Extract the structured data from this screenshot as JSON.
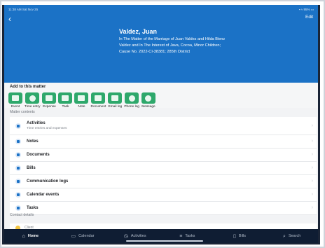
{
  "status_bar": {
    "time_date": "11:38 AM  Sat Nov 25",
    "battery": "▪︎ ≈ 95% ▭"
  },
  "header": {
    "back_glyph": "‹",
    "edit_label": "Edit",
    "client_name": "Valdez, Juan",
    "matter_description": "In The Matter of the Marriage of Juan Valdez and Hilda Bienz Valdez and In The Interest of Java, Cocoa, Minor Children; Cause No. 2022-CI-38381; 285th District"
  },
  "add_to_matter": {
    "title": "Add to this matter",
    "actions": [
      {
        "label": "Event",
        "icon": "calendar-icon"
      },
      {
        "label": "Time entry",
        "icon": "clock-icon"
      },
      {
        "label": "Expense",
        "icon": "receipt-icon"
      },
      {
        "label": "Task",
        "icon": "task-icon"
      },
      {
        "label": "Note",
        "icon": "note-icon"
      },
      {
        "label": "Document",
        "icon": "document-icon"
      },
      {
        "label": "Email log",
        "icon": "email-icon"
      },
      {
        "label": "Phone log",
        "icon": "phone-icon"
      },
      {
        "label": "Message",
        "icon": "message-icon"
      }
    ]
  },
  "matter_contents": {
    "heading": "Matter contents",
    "items": [
      {
        "label": "Activities",
        "sub": "Time entries and expenses",
        "icon": "activities-icon"
      },
      {
        "label": "Notes",
        "icon": "note-icon"
      },
      {
        "label": "Documents",
        "icon": "document-icon"
      },
      {
        "label": "Bills",
        "icon": "bill-icon"
      },
      {
        "label": "Communication logs",
        "icon": "phone-icon"
      },
      {
        "label": "Calendar events",
        "icon": "calendar-icon"
      },
      {
        "label": "Tasks",
        "icon": "task-icon"
      }
    ]
  },
  "contact_details": {
    "heading": "Contact details",
    "client_label": "Client"
  },
  "tabbar": {
    "tabs": [
      {
        "label": "Home",
        "icon": "home-icon",
        "glyph": "⌂"
      },
      {
        "label": "Calendar",
        "icon": "calendar-icon",
        "glyph": "▭"
      },
      {
        "label": "Activities",
        "icon": "clock-icon",
        "glyph": "◷"
      },
      {
        "label": "Tasks",
        "icon": "list-icon",
        "glyph": "≡"
      },
      {
        "label": "Bills",
        "icon": "bill-icon",
        "glyph": "▯"
      },
      {
        "label": "Search",
        "icon": "search-icon",
        "glyph": "⌕"
      }
    ]
  },
  "colors": {
    "header": "#1b72c6",
    "action_green": "#2ea86b",
    "tabbar": "#0f1d33"
  }
}
